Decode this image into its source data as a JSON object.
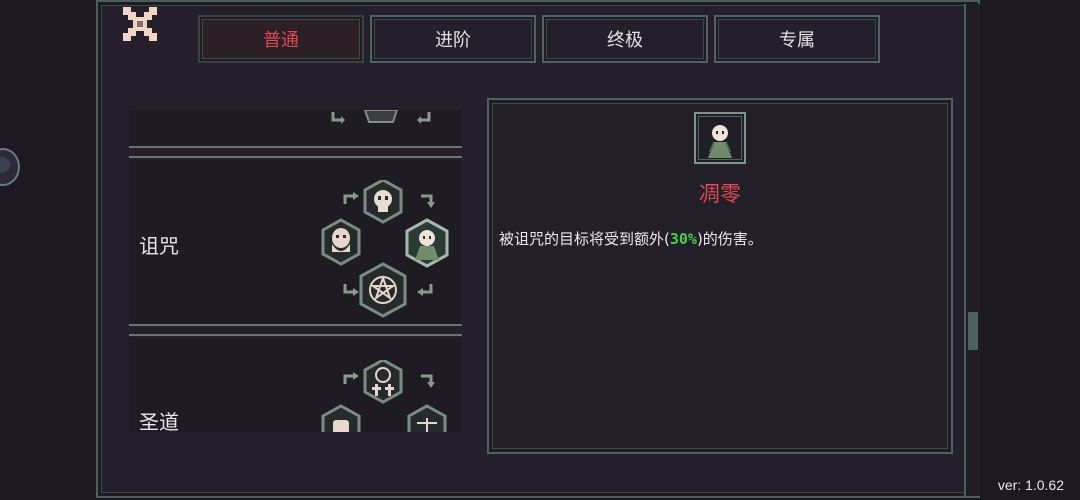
{
  "tabs": [
    {
      "label": "普通",
      "active": true
    },
    {
      "label": "进阶",
      "active": false
    },
    {
      "label": "终极",
      "active": false
    },
    {
      "label": "专属",
      "active": false
    }
  ],
  "categories": [
    {
      "label": "诅咒"
    },
    {
      "label": "圣道"
    }
  ],
  "detail": {
    "title": "凋零",
    "desc_before": "被诅咒的目标将受到额外(",
    "desc_highlight": "30%",
    "desc_after": ")的伤害。"
  },
  "version": "ver: 1.0.62",
  "colors": {
    "accent_red": "#e04a57",
    "highlight_green": "#45d34c",
    "frame_teal": "#4e6462"
  },
  "icons": [
    "close-icon",
    "skull-icon",
    "ghost-icon",
    "monk-icon",
    "pentagram-icon",
    "holy-symbol-icon",
    "fist-icon",
    "scales-icon",
    "arrow-icon"
  ]
}
